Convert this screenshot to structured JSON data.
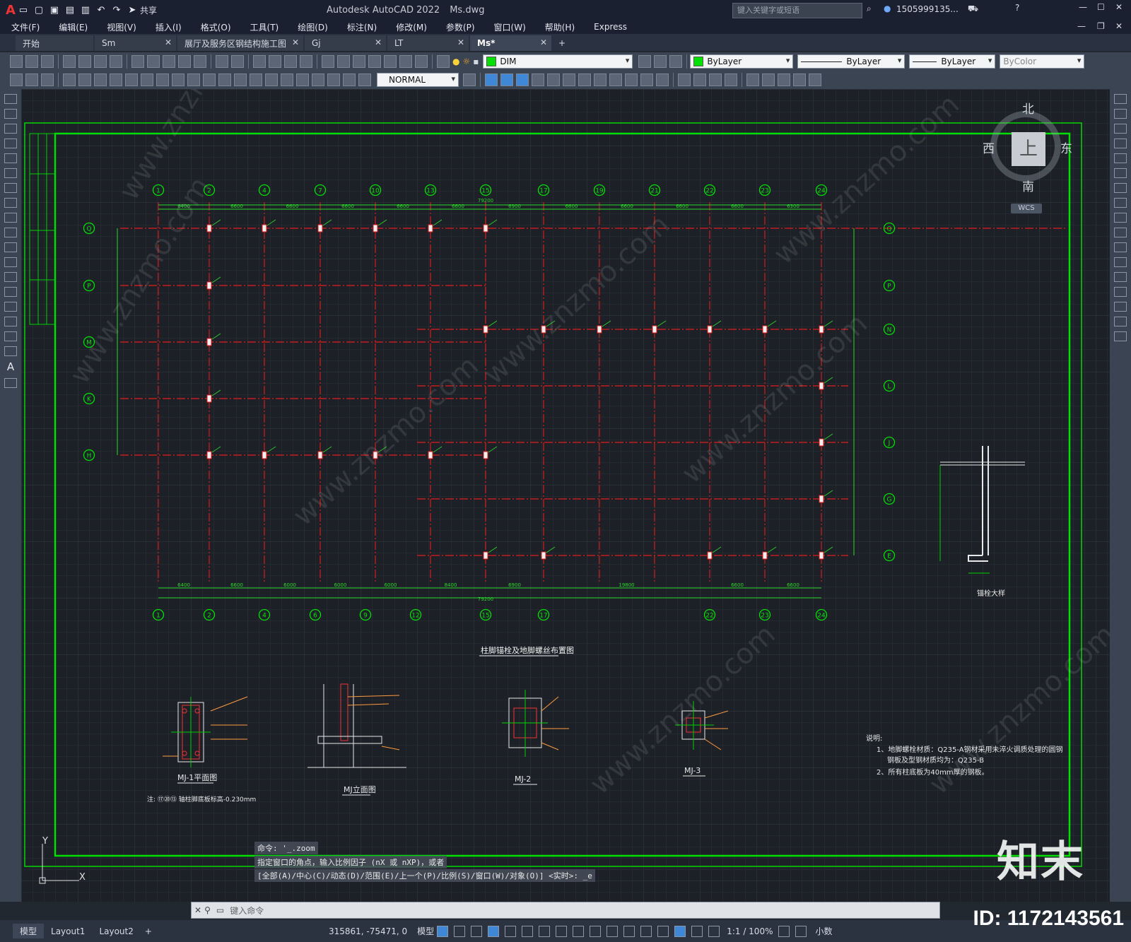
{
  "app": {
    "title": "Autodesk AutoCAD 2022",
    "file": "Ms.dwg",
    "search_placeholder": "键入关键字或短语",
    "user": "1505999135...",
    "share_label": "共享"
  },
  "menu": [
    "文件(F)",
    "编辑(E)",
    "视图(V)",
    "插入(I)",
    "格式(O)",
    "工具(T)",
    "绘图(D)",
    "标注(N)",
    "修改(M)",
    "参数(P)",
    "窗口(W)",
    "帮助(H)",
    "Express"
  ],
  "tabs": [
    {
      "label": "开始",
      "closable": false
    },
    {
      "label": "Sm",
      "closable": true
    },
    {
      "label": "展厅及服务区钢结构施工图",
      "closable": true
    },
    {
      "label": "Gj",
      "closable": true
    },
    {
      "label": "LT",
      "closable": true
    },
    {
      "label": "Ms*",
      "closable": true,
      "active": true
    }
  ],
  "toolbar": {
    "layer": "DIM",
    "color": "ByLayer",
    "linetype": "ByLayer",
    "lineweight": "ByLayer",
    "plotstyle": "ByColor",
    "textstyle": "NORMAL"
  },
  "compass": {
    "north": "北",
    "south": "南",
    "east": "东",
    "west": "西",
    "top": "上",
    "ucs": "WCS"
  },
  "drawing": {
    "title": "展厅及服务区钢结构施工图",
    "plan_title": "柱脚锚栓及地脚螺丝布置图",
    "top_axes": [
      "1",
      "2",
      "4",
      "7",
      "10",
      "13",
      "15",
      "17",
      "19",
      "21",
      "22",
      "23",
      "24"
    ],
    "bottom_axes": [
      "1",
      "2",
      "4",
      "6",
      "9",
      "12",
      "15",
      "17",
      "22",
      "23",
      "24"
    ],
    "left_axes": [
      "Q",
      "P",
      "M",
      "K",
      "H"
    ],
    "right_axes": [
      "Q",
      "P",
      "N",
      "L",
      "J",
      "G",
      "E"
    ],
    "top_dims": [
      "6400",
      "6600",
      "6600",
      "6600",
      "6600",
      "6600",
      "6900",
      "6600",
      "6600",
      "6600",
      "6600",
      "6300"
    ],
    "top_total": "79200",
    "bottom_dims": [
      "6400",
      "6600",
      "6000",
      "6000",
      "6000",
      "8400",
      "6900",
      "19800",
      "6600",
      "6600"
    ],
    "bottom_total": "79200",
    "details": [
      {
        "label": "MJ-1平面图",
        "note": "注: ⑰⑳⑬ 轴柱脚底板标高-0.230mm"
      },
      {
        "label": "MJ立面图"
      },
      {
        "label": "MJ-2"
      },
      {
        "label": "MJ-3"
      }
    ],
    "anchor_detail": "锚栓大样",
    "notes": {
      "heading": "说明:",
      "lines": [
        "1、地脚螺栓材质：Q235-A钢材采用未淬火调质处理的圆钢",
        "钢板及型钢材质均为：Q235-B",
        "2、所有柱底板为40mm厚的钢板。"
      ]
    },
    "watermark": "www.znzmo.com",
    "ucs_icon": {
      "x": "X",
      "y": "Y"
    }
  },
  "command": {
    "history": [
      "命令: '_.zoom",
      "指定窗口的角点，输入比例因子 (nX 或 nXP)，或者",
      "[全部(A)/中心(C)/动态(D)/范围(E)/上一个(P)/比例(S)/窗口(W)/对象(O)] <实时>: _e"
    ],
    "placeholder": "键入命令"
  },
  "status": {
    "layout_tabs": [
      "模型",
      "Layout1",
      "Layout2"
    ],
    "coords": "315861, -75471, 0",
    "mode": "模型",
    "scale": "1:1 / 100%",
    "units": "小数"
  },
  "brand": {
    "logo": "知末",
    "id": "ID: 1172143561"
  },
  "colors": {
    "grid_line": "#e21c1c",
    "axis_green": "#00e000",
    "dim_green": "#28d828",
    "bg": "#1d2127",
    "orange": "#ff9a3c"
  }
}
